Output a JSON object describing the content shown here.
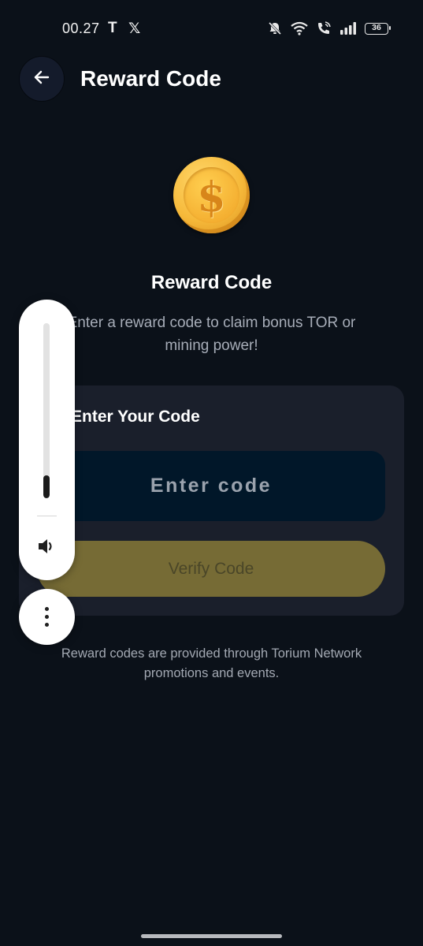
{
  "status_bar": {
    "time": "00.27",
    "app_icons": [
      "T",
      "𝕏"
    ],
    "icons": [
      "bell-off-icon",
      "wifi-icon",
      "wifi-calling-icon",
      "signal-icon",
      "battery-icon"
    ],
    "battery": "36"
  },
  "header": {
    "title": "Reward Code",
    "back_icon": "arrow-left-icon"
  },
  "hero": {
    "icon": "dollar-coin-icon",
    "coin_symbol": "$",
    "title": "Reward Code",
    "description": "Enter a reward code to claim bonus TOR or mining power!"
  },
  "code_card": {
    "label": "Enter Your Code",
    "input_placeholder": "Enter code",
    "input_value": "",
    "verify_label": "Verify Code"
  },
  "footer_note": "Reward codes are provided through Torium Network promotions and events.",
  "volume_overlay": {
    "level": 0.13,
    "speaker_icon": "speaker-icon",
    "more_icon": "more-vertical-icon"
  },
  "colors": {
    "background": "#0b1119",
    "card": "#1a1f2b",
    "input": "#011729",
    "verify_button": "#766b35",
    "coin": "#f6b93a"
  }
}
